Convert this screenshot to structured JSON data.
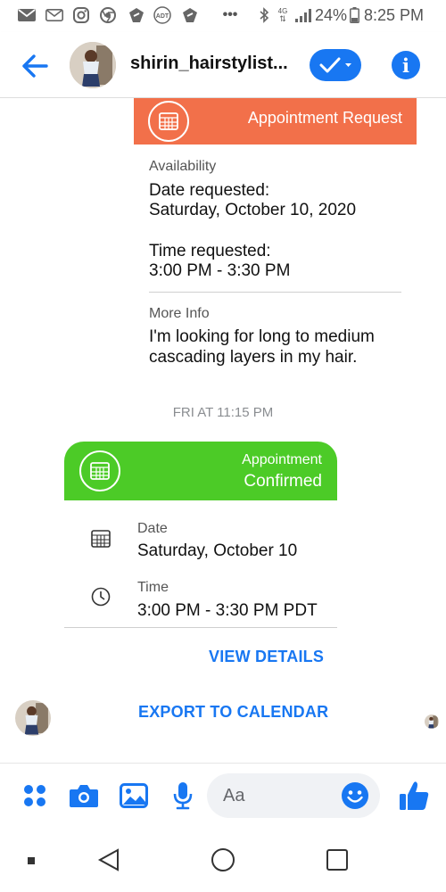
{
  "status_bar": {
    "battery": "24%",
    "time": "8:25 PM",
    "network_label": "4G",
    "icons": [
      "email-icon",
      "mail-icon",
      "instagram-icon",
      "chrome-icon",
      "adt-shield-icon",
      "adt-icon",
      "adt-shield-icon",
      "more-dots-icon",
      "bluetooth-icon",
      "network-4g-icon",
      "signal-icon",
      "battery-icon"
    ]
  },
  "header": {
    "back_icon": "arrow-back-icon",
    "name": "shirin_hairstylist...",
    "check_icon": "check-icon",
    "info_label": "i"
  },
  "request": {
    "title": "Appointment Request",
    "availability_label": "Availability",
    "date_label": "Date requested:",
    "date_value": "Saturday, October 10, 2020",
    "time_label": "Time requested:",
    "time_value": "3:00 PM - 3:30 PM",
    "more_info_label": "More Info",
    "more_info_line1": "I'm looking for long to medium",
    "more_info_line2": "cascading layers in my hair."
  },
  "timestamp": "FRI AT 11:15 PM",
  "confirmed": {
    "title_line1": "Appointment",
    "title_line2": "Confirmed",
    "date_label": "Date",
    "date_value": "Saturday, October 10",
    "time_label": "Time",
    "time_value": "3:00 PM - 3:30 PM PDT",
    "view_details": "VIEW DETAILS",
    "export": "EXPORT TO CALENDAR"
  },
  "composer": {
    "placeholder": "Aa",
    "icons": [
      "menu-dots-icon",
      "camera-icon",
      "image-icon",
      "microphone-icon",
      "emoji-icon",
      "thumbs-up-icon"
    ]
  },
  "navbar": {
    "icons": [
      "recent-square-icon",
      "back-triangle-icon",
      "home-circle-icon",
      "overview-square-icon"
    ]
  },
  "colors": {
    "accent": "#1877f2",
    "request_header": "#f2704a",
    "confirmed_header": "#4ccb27"
  }
}
